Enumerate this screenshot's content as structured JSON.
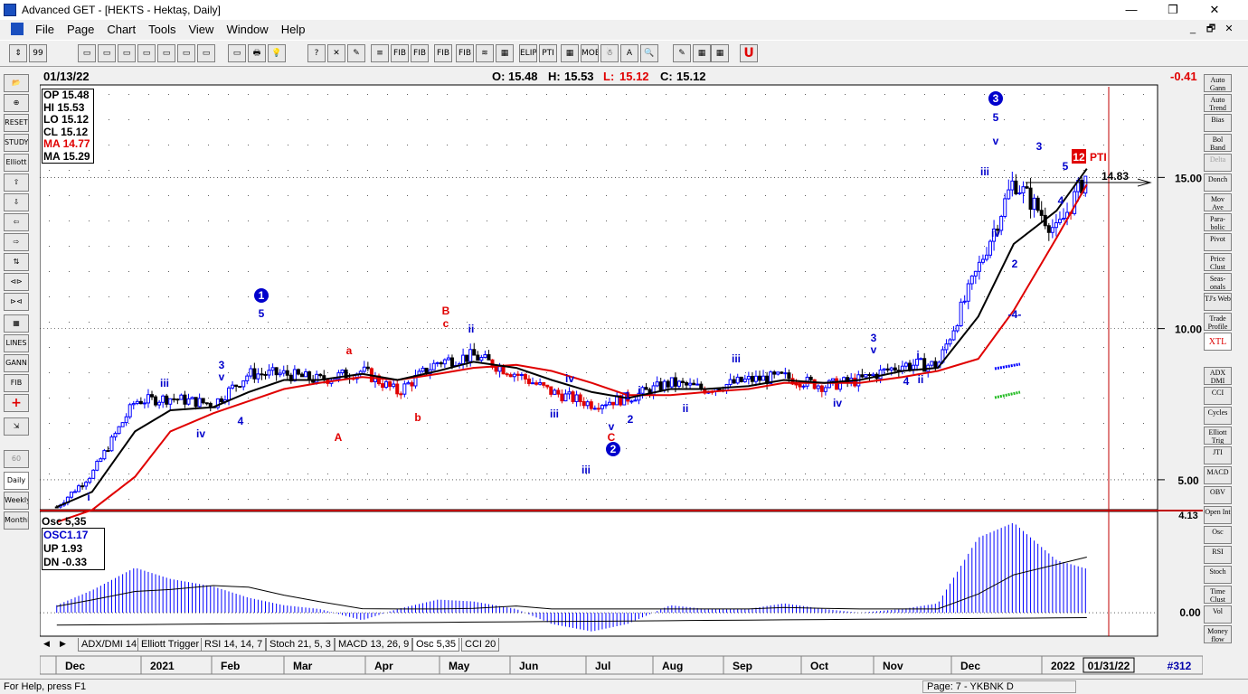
{
  "window": {
    "title": "Advanced GET - [HEKTS - Hektaş, Daily]",
    "minimize": "—",
    "maximize": "❐",
    "close": "✕"
  },
  "menu": [
    "File",
    "Page",
    "Chart",
    "Tools",
    "View",
    "Window",
    "Help"
  ],
  "doc_controls": [
    "_",
    "🗗",
    "✕"
  ],
  "toolbar": [
    "⇕",
    "99",
    "▭",
    "▭",
    "▭",
    "▭",
    "▭",
    "▭",
    "▭",
    "▭",
    "🖶",
    "💡",
    "?",
    "✕",
    "✎",
    "≡",
    "FIB RET",
    "FIB EXT",
    "FIB TIME",
    "FIB",
    "≋",
    "▦",
    "ELIPS",
    "PTI",
    "▦",
    "MOB",
    "☃",
    "A",
    "🔍",
    "✎",
    "▦",
    "▦",
    "U"
  ],
  "left_tools": [
    "📂",
    "⊕",
    "RESET",
    "STUDY",
    "Elliott",
    "⇧",
    "⇩",
    "⇦",
    "⇨",
    "⇅",
    "⊲⊳",
    "⊳⊲",
    "▦",
    "LINES",
    "GANN",
    "FIB",
    "+",
    "⇲",
    "60 Minute",
    "Daily",
    "Weekly",
    "Monthly"
  ],
  "right_tools": [
    "Auto Gann",
    "Auto Trend",
    "Bias",
    "Bol Band",
    "Delta",
    "Donch",
    "Mov Ave",
    "Para-bolic",
    "Pivot",
    "Price Clust",
    "Seas-onals",
    "TJ's Web",
    "Trade Profile",
    "XTL",
    "ADX DMI",
    "CCI",
    "Cycles",
    "Elliott Trig",
    "JTI",
    "MACD",
    "OBV",
    "Open Int",
    "Osc",
    "RSI",
    "Stoch",
    "Time Clust",
    "Vol",
    "Money flow"
  ],
  "quote": {
    "date": "01/13/22",
    "open_label": "O:",
    "open": "15.48",
    "high_label": "H:",
    "high": "15.53",
    "low_label": "L:",
    "low": "15.12",
    "close_label": "C:",
    "close": "15.12",
    "change": "-0.41"
  },
  "info_box": [
    {
      "label": "OP",
      "value": "15.48",
      "color": "#000000"
    },
    {
      "label": "HI",
      "value": "15.53",
      "color": "#000000"
    },
    {
      "label": "LO",
      "value": "15.12",
      "color": "#000000"
    },
    {
      "label": "CL",
      "value": "15.12",
      "color": "#000000"
    },
    {
      "label": "MA",
      "value": "14.77",
      "color": "#e00000"
    },
    {
      "label": "MA",
      "value": "15.29",
      "color": "#000000"
    }
  ],
  "osc_box": {
    "title": "Osc 5,35",
    "rows": [
      {
        "label": "OSC",
        "value": "1.17",
        "color": "#0000cc"
      },
      {
        "label": "UP",
        "value": "1.93",
        "color": "#000000"
      },
      {
        "label": "DN",
        "value": "-0.33",
        "color": "#000000"
      }
    ]
  },
  "price_axis": [
    "15.00",
    "10.00",
    "5.00",
    "4.13"
  ],
  "osc_axis": [
    "0.00"
  ],
  "months": [
    "Dec",
    "2021",
    "Feb",
    "Mar",
    "Apr",
    "May",
    "Jun",
    "Jul",
    "Aug",
    "Sep",
    "Oct",
    "Nov",
    "Dec",
    "2022"
  ],
  "future_date": "01/31/22",
  "page_number": "#312",
  "target_label": "14.83",
  "pti": {
    "value": "12",
    "label": "PTI"
  },
  "elliott_labels": [
    {
      "t": "1",
      "color": "#0000cc",
      "circle": true
    },
    {
      "t": "2",
      "color": "#0000cc",
      "circle": true
    },
    {
      "t": "3",
      "color": "#0000cc",
      "circle": true
    },
    {
      "t": "i"
    },
    {
      "t": "iii"
    },
    {
      "t": "iv"
    },
    {
      "t": "3"
    },
    {
      "t": "v"
    },
    {
      "t": "4"
    },
    {
      "t": "5"
    },
    {
      "t": "a"
    },
    {
      "t": "A"
    },
    {
      "t": "b"
    },
    {
      "t": "B"
    },
    {
      "t": "c"
    },
    {
      "t": "ii"
    },
    {
      "t": "iii"
    },
    {
      "t": "iv"
    },
    {
      "t": "iii"
    },
    {
      "t": "C"
    },
    {
      "t": "v"
    },
    {
      "t": "1"
    },
    {
      "t": "i"
    },
    {
      "t": "2"
    },
    {
      "t": "ii"
    },
    {
      "t": "iii"
    },
    {
      "t": "iv"
    },
    {
      "t": "3"
    },
    {
      "t": "v"
    },
    {
      "t": "i"
    },
    {
      "t": "4"
    },
    {
      "t": "ii"
    },
    {
      "t": "iii"
    },
    {
      "t": "5"
    },
    {
      "t": "v"
    },
    {
      "t": "iv"
    },
    {
      "t": "2"
    },
    {
      "t": "-4-"
    },
    {
      "t": "3"
    },
    {
      "t": "5"
    },
    {
      "t": "4"
    }
  ],
  "tabs": [
    "ADX/DMI 14",
    "Elliott Trigger",
    "RSI 14, 14, 7",
    "Stoch 21, 5, 3",
    "MACD 13, 26, 9",
    "Osc 5,35",
    "CCI 20"
  ],
  "selected_tab": "Osc 5,35",
  "status": {
    "help": "For Help, press F1",
    "page": "Page: 7 - YKBNK D"
  },
  "colors": {
    "bull_bar": "#0000ff",
    "bear_bar": "#000000",
    "bear_bar_down": "#e00000",
    "ma_fast": "#000000",
    "ma_slow": "#e00000",
    "time_line": "#c00000"
  },
  "chart_data": {
    "type": "line",
    "title": "HEKTS - Hektaş, Daily",
    "x": [
      "2020-12-01",
      "2020-12-15",
      "2021-01-01",
      "2021-01-15",
      "2021-02-01",
      "2021-02-15",
      "2021-03-01",
      "2021-03-15",
      "2021-04-01",
      "2021-04-15",
      "2021-05-01",
      "2021-05-15",
      "2021-06-01",
      "2021-06-15",
      "2021-07-01",
      "2021-07-15",
      "2021-08-01",
      "2021-08-15",
      "2021-09-01",
      "2021-09-15",
      "2021-10-01",
      "2021-10-15",
      "2021-11-01",
      "2021-11-15",
      "2021-12-01",
      "2021-12-15",
      "2022-01-01",
      "2022-01-13"
    ],
    "series": [
      {
        "name": "Price",
        "values": [
          4.1,
          5.2,
          7.6,
          7.7,
          7.5,
          8.5,
          8.5,
          8.3,
          8.6,
          7.9,
          8.9,
          9.1,
          8.5,
          7.9,
          7.5,
          7.7,
          8.2,
          8.0,
          8.3,
          8.4,
          8.1,
          8.3,
          8.8,
          8.8,
          12.0,
          14.9,
          13.2,
          15.12
        ]
      },
      {
        "name": "MA",
        "values": [
          4.1,
          4.6,
          6.6,
          7.3,
          7.4,
          7.9,
          8.3,
          8.3,
          8.5,
          8.3,
          8.6,
          8.9,
          8.7,
          8.3,
          7.9,
          7.7,
          8.0,
          8.0,
          8.1,
          8.3,
          8.2,
          8.3,
          8.6,
          8.7,
          10.4,
          12.8,
          13.9,
          15.29
        ]
      },
      {
        "name": "MA",
        "values": [
          3.6,
          4.0,
          5.1,
          6.6,
          7.2,
          7.6,
          8.0,
          8.2,
          8.4,
          8.3,
          8.5,
          8.7,
          8.8,
          8.6,
          8.2,
          7.8,
          7.8,
          7.9,
          8.0,
          8.2,
          8.2,
          8.2,
          8.4,
          8.6,
          9.0,
          10.6,
          13.0,
          14.77
        ]
      }
    ],
    "ylim": [
      4.13,
      18.0
    ],
    "yticks": [
      5.0,
      10.0,
      15.0
    ],
    "grid": true
  },
  "osc_data": {
    "type": "bar",
    "name": "Osc 5,35",
    "x": [
      "2020-12-01",
      "2020-12-15",
      "2021-01-01",
      "2021-01-15",
      "2021-02-01",
      "2021-02-15",
      "2021-03-01",
      "2021-03-15",
      "2021-04-01",
      "2021-04-15",
      "2021-05-01",
      "2021-05-15",
      "2021-06-01",
      "2021-06-15",
      "2021-07-01",
      "2021-07-15",
      "2021-08-01",
      "2021-08-15",
      "2021-09-01",
      "2021-09-15",
      "2021-10-01",
      "2021-10-15",
      "2021-11-01",
      "2021-11-15",
      "2021-12-01",
      "2021-12-15",
      "2022-01-01",
      "2022-01-13"
    ],
    "values": [
      0.2,
      0.6,
      1.2,
      0.9,
      0.7,
      0.4,
      0.2,
      0.1,
      -0.2,
      0.1,
      0.35,
      0.3,
      0.1,
      -0.3,
      -0.5,
      -0.3,
      0.2,
      0.1,
      0.1,
      0.25,
      0.1,
      0.0,
      0.1,
      0.25,
      2.0,
      2.4,
      1.4,
      1.17
    ],
    "up_band": 1.93,
    "down_band": -0.33,
    "ylim": [
      -0.6,
      2.6
    ]
  }
}
